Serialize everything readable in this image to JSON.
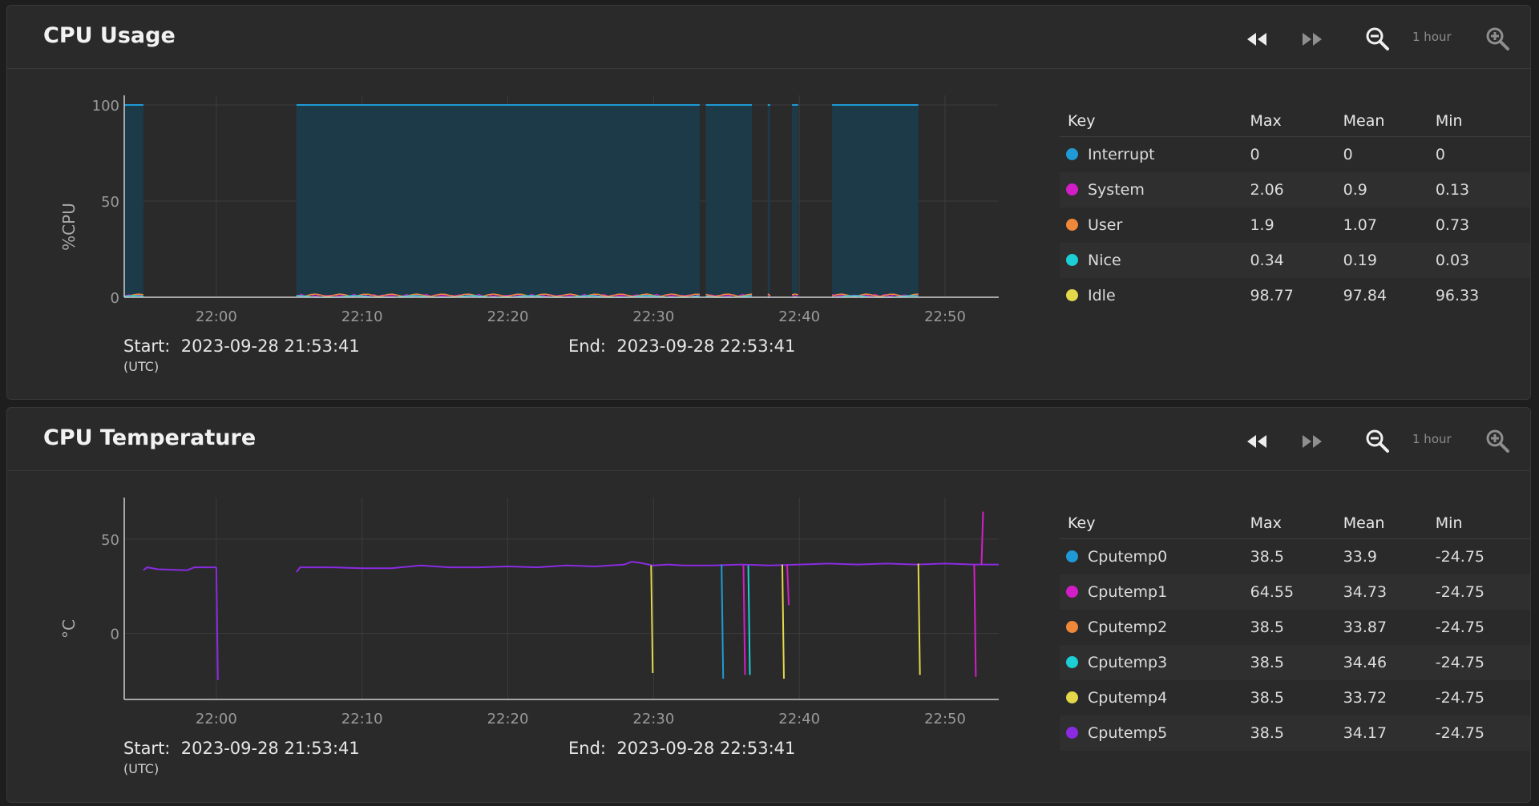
{
  "panels": [
    {
      "title": "CPU Usage",
      "range_label": "1 hour",
      "start_label": "Start:",
      "start_value": "2023-09-28 21:53:41",
      "utc_label": "(UTC)",
      "end_label": "End:",
      "end_value": "2023-09-28 22:53:41",
      "key": {
        "headers": [
          "Key",
          "Max",
          "Mean",
          "Min"
        ],
        "rows": [
          {
            "name": "Interrupt",
            "max": "0",
            "mean": "0",
            "min": "0",
            "color": "#1f9ad6"
          },
          {
            "name": "System",
            "max": "2.06",
            "mean": "0.9",
            "min": "0.13",
            "color": "#d31ec8"
          },
          {
            "name": "User",
            "max": "1.9",
            "mean": "1.07",
            "min": "0.73",
            "color": "#f0883a"
          },
          {
            "name": "Nice",
            "max": "0.34",
            "mean": "0.19",
            "min": "0.03",
            "color": "#1ccfd6"
          },
          {
            "name": "Idle",
            "max": "98.77",
            "mean": "97.84",
            "min": "96.33",
            "color": "#e3d84a"
          }
        ]
      }
    },
    {
      "title": "CPU Temperature",
      "range_label": "1 hour",
      "start_label": "Start:",
      "start_value": "2023-09-28 21:53:41",
      "utc_label": "(UTC)",
      "end_label": "End:",
      "end_value": "2023-09-28 22:53:41",
      "key": {
        "headers": [
          "Key",
          "Max",
          "Mean",
          "Min"
        ],
        "rows": [
          {
            "name": "Cputemp0",
            "max": "38.5",
            "mean": "33.9",
            "min": "-24.75",
            "color": "#1f9ad6"
          },
          {
            "name": "Cputemp1",
            "max": "64.55",
            "mean": "34.73",
            "min": "-24.75",
            "color": "#d31ec8"
          },
          {
            "name": "Cputemp2",
            "max": "38.5",
            "mean": "33.87",
            "min": "-24.75",
            "color": "#f0883a"
          },
          {
            "name": "Cputemp3",
            "max": "38.5",
            "mean": "34.46",
            "min": "-24.75",
            "color": "#1ccfd6"
          },
          {
            "name": "Cputemp4",
            "max": "38.5",
            "mean": "33.72",
            "min": "-24.75",
            "color": "#e3d84a"
          },
          {
            "name": "Cputemp5",
            "max": "38.5",
            "mean": "34.17",
            "min": "-24.75",
            "color": "#8a2be2"
          }
        ]
      }
    }
  ],
  "icons": {
    "rewind": "rewind-icon",
    "fast_forward": "fast-forward-icon",
    "zoom_out": "zoom-out-icon",
    "zoom_in": "zoom-in-icon"
  },
  "chart_data": [
    {
      "type": "area",
      "ylabel": "%CPU",
      "ylim": [
        0,
        105
      ],
      "xlim": [
        "21:53:41",
        "22:53:41"
      ],
      "yticks": [
        0,
        50,
        100
      ],
      "xticks": [
        "22:00",
        "22:10",
        "22:20",
        "22:30",
        "22:40",
        "22:50"
      ],
      "grid": true,
      "segments": [
        {
          "start": "21:53:41",
          "end": "21:55:00"
        },
        {
          "start": "22:05:30",
          "end": "22:33:10"
        },
        {
          "start": "22:33:35",
          "end": "22:36:45"
        },
        {
          "start": "22:37:50",
          "end": "22:38:00"
        },
        {
          "start": "22:39:30",
          "end": "22:39:55"
        },
        {
          "start": "22:42:15",
          "end": "22:48:10"
        }
      ],
      "series": [
        {
          "name": "Idle",
          "approx_value": 97.84,
          "color": "#1f9ad6"
        },
        {
          "name": "System",
          "approx_value": 0.9,
          "color": "#d31ec8"
        },
        {
          "name": "User",
          "approx_value": 1.07,
          "color": "#f0883a"
        },
        {
          "name": "Nice",
          "approx_value": 0.19,
          "color": "#1ccfd6"
        }
      ]
    },
    {
      "type": "line",
      "ylabel": "°C",
      "ylim": [
        -35,
        72
      ],
      "xlim": [
        "21:53:41",
        "22:53:41"
      ],
      "yticks": [
        0,
        50
      ],
      "xticks": [
        "22:00",
        "22:10",
        "22:20",
        "22:30",
        "22:40",
        "22:50"
      ],
      "grid": true,
      "baseline": [
        [
          "21:55:00",
          33.5
        ],
        [
          "21:55:15",
          35.0
        ],
        [
          "21:56:00",
          34.0
        ],
        [
          "21:58:00",
          33.5
        ],
        [
          "21:58:30",
          35.0
        ],
        [
          "22:00:00",
          35.0
        ],
        [
          "22:05:30",
          32.5
        ],
        [
          "22:05:45",
          35.0
        ],
        [
          "22:08:00",
          35.0
        ],
        [
          "22:10:00",
          34.5
        ],
        [
          "22:12:00",
          34.5
        ],
        [
          "22:14:00",
          36.0
        ],
        [
          "22:16:00",
          35.0
        ],
        [
          "22:18:00",
          35.0
        ],
        [
          "22:20:00",
          35.5
        ],
        [
          "22:22:00",
          35.0
        ],
        [
          "22:24:00",
          36.0
        ],
        [
          "22:26:00",
          35.5
        ],
        [
          "22:28:00",
          36.5
        ],
        [
          "22:28:30",
          38.0
        ],
        [
          "22:29:00",
          37.5
        ],
        [
          "22:30:00",
          36.0
        ],
        [
          "22:31:00",
          36.5
        ],
        [
          "22:32:00",
          36.0
        ],
        [
          "22:34:00",
          36.0
        ],
        [
          "22:36:00",
          36.5
        ],
        [
          "22:38:00",
          36.0
        ],
        [
          "22:40:00",
          36.5
        ],
        [
          "22:42:00",
          37.0
        ],
        [
          "22:44:00",
          36.5
        ],
        [
          "22:46:00",
          37.0
        ],
        [
          "22:48:00",
          36.5
        ],
        [
          "22:50:00",
          37.0
        ],
        [
          "22:52:00",
          36.5
        ],
        [
          "22:53:41",
          36.5
        ]
      ],
      "dips": [
        {
          "series": "Cputemp5",
          "time": "22:00:00",
          "to": -24.75
        },
        {
          "series": "Cputemp4",
          "time": "22:29:50",
          "to": -21
        },
        {
          "series": "Cputemp0",
          "time": "22:34:40",
          "to": -24
        },
        {
          "series": "Cputemp1",
          "time": "22:36:10",
          "to": -22
        },
        {
          "series": "Cputemp3",
          "time": "22:36:30",
          "to": -22
        },
        {
          "series": "Cputemp4",
          "time": "22:38:50",
          "to": -24
        },
        {
          "series": "Cputemp1",
          "time": "22:39:10",
          "to": 15
        },
        {
          "series": "Cputemp4",
          "time": "22:48:10",
          "to": -22
        },
        {
          "series": "Cputemp1",
          "time": "22:52:00",
          "to": -23
        },
        {
          "series": "Cputemp1",
          "time": "22:52:30",
          "to": 64.55
        }
      ]
    }
  ]
}
